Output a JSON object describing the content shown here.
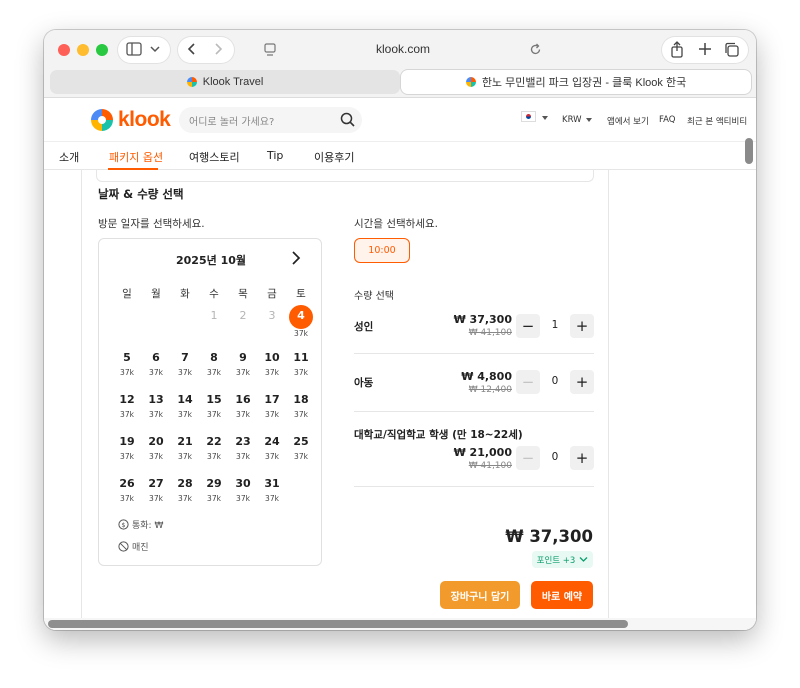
{
  "browser": {
    "address": "klook.com",
    "tabs": [
      {
        "label": "Klook Travel"
      },
      {
        "label": "한노 무민밸리 파크 입장권 - 클룩 Klook 한국"
      }
    ]
  },
  "header": {
    "logo_text": "klook",
    "search_placeholder": "어디로 놀러 가세요?",
    "currency": "KRW",
    "links": [
      "앱에서 보기",
      "FAQ",
      "최근 본 액티비티"
    ]
  },
  "nav": {
    "items": [
      {
        "label": "소개"
      },
      {
        "label": "패키지 옵션"
      },
      {
        "label": "여행스토리"
      },
      {
        "label": "Tip"
      },
      {
        "label": "이용후기"
      }
    ],
    "active_index": 1
  },
  "booking": {
    "section_title": "날짜 & 수량 선택",
    "date_prompt": "방문 일자를 선택하세요.",
    "time_prompt": "시간을 선택하세요.",
    "time_option": "10:00",
    "quantity_title": "수량 선택",
    "calendar": {
      "month_label": "2025년 10월",
      "weekdays": [
        "일",
        "월",
        "화",
        "수",
        "목",
        "금",
        "토"
      ],
      "days": [
        {
          "d": "1",
          "price": "",
          "state": "disabled"
        },
        {
          "d": "2",
          "price": "",
          "state": "disabled"
        },
        {
          "d": "3",
          "price": "",
          "state": "disabled"
        },
        {
          "d": "4",
          "price": "37k",
          "state": "selected"
        },
        {
          "d": "5",
          "price": "37k",
          "state": "available"
        },
        {
          "d": "6",
          "price": "37k",
          "state": "available"
        },
        {
          "d": "7",
          "price": "37k",
          "state": "available"
        },
        {
          "d": "8",
          "price": "37k",
          "state": "available"
        },
        {
          "d": "9",
          "price": "37k",
          "state": "available"
        },
        {
          "d": "10",
          "price": "37k",
          "state": "available"
        },
        {
          "d": "11",
          "price": "37k",
          "state": "available"
        },
        {
          "d": "12",
          "price": "37k",
          "state": "available"
        },
        {
          "d": "13",
          "price": "37k",
          "state": "available"
        },
        {
          "d": "14",
          "price": "37k",
          "state": "available"
        },
        {
          "d": "15",
          "price": "37k",
          "state": "available"
        },
        {
          "d": "16",
          "price": "37k",
          "state": "available"
        },
        {
          "d": "17",
          "price": "37k",
          "state": "available"
        },
        {
          "d": "18",
          "price": "37k",
          "state": "available"
        },
        {
          "d": "19",
          "price": "37k",
          "state": "available"
        },
        {
          "d": "20",
          "price": "37k",
          "state": "available"
        },
        {
          "d": "21",
          "price": "37k",
          "state": "available"
        },
        {
          "d": "22",
          "price": "37k",
          "state": "available"
        },
        {
          "d": "23",
          "price": "37k",
          "state": "available"
        },
        {
          "d": "24",
          "price": "37k",
          "state": "available"
        },
        {
          "d": "25",
          "price": "37k",
          "state": "available"
        },
        {
          "d": "26",
          "price": "37k",
          "state": "available"
        },
        {
          "d": "27",
          "price": "37k",
          "state": "available"
        },
        {
          "d": "28",
          "price": "37k",
          "state": "available"
        },
        {
          "d": "29",
          "price": "37k",
          "state": "available"
        },
        {
          "d": "30",
          "price": "37k",
          "state": "available"
        },
        {
          "d": "31",
          "price": "37k",
          "state": "available"
        }
      ],
      "legend_currency": "통화: ₩",
      "legend_soldout": "매진"
    },
    "quantities": [
      {
        "label": "성인",
        "price": "₩ 37,300",
        "original": "₩ 41,100",
        "count": "1"
      },
      {
        "label": "아동",
        "price": "₩ 4,800",
        "original": "₩ 12,400",
        "count": "0"
      },
      {
        "label": "대학교/직업학교 학생 (만 18~22세)",
        "price": "₩ 21,000",
        "original": "₩ 41,100",
        "count": "0"
      }
    ],
    "total": "₩ 37,300",
    "points": "포인트 +3",
    "cart_button": "장바구니 담기",
    "book_button": "바로 예약"
  },
  "colors": {
    "brand": "#ff5b00",
    "cart": "#f29b2c",
    "points_green": "#0a9e6e"
  }
}
